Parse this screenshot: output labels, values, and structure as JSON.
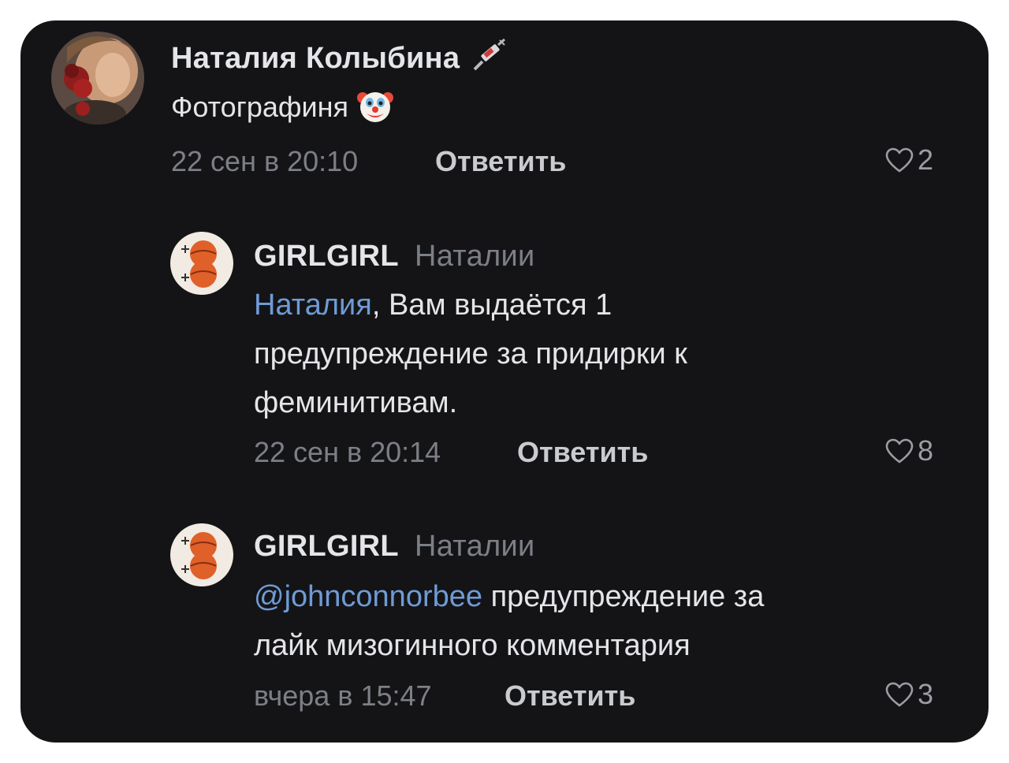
{
  "comments": [
    {
      "author": "Наталия Колыбина",
      "status_text": "Фотографиня",
      "author_icon": "syringe-icon",
      "status_icon": "clown-face-icon",
      "timestamp": "22 сен в 20:10",
      "reply_label": "Ответить",
      "likes": "2"
    },
    {
      "author": "GIRLGIRL",
      "reply_to": "Наталии",
      "mention": "Наталия",
      "text_after_mention": ", Вам выдаётся 1",
      "text_lines": [
        "предупреждение за придирки к",
        "феминитивам."
      ],
      "timestamp": "22 сен в 20:14",
      "reply_label": "Ответить",
      "likes": "8"
    },
    {
      "author": "GIRLGIRL",
      "reply_to": "Наталии",
      "mention": "@johnconnorbee",
      "text_after_mention": " предупреждение за",
      "text_lines": [
        "лайк мизогинного комментария"
      ],
      "timestamp": "вчера в 15:47",
      "reply_label": "Ответить",
      "likes": "3"
    }
  ],
  "colors": {
    "background": "#141416",
    "text": "#e4e5e8",
    "muted": "#7c7f86",
    "mention": "#6f9bd6"
  }
}
